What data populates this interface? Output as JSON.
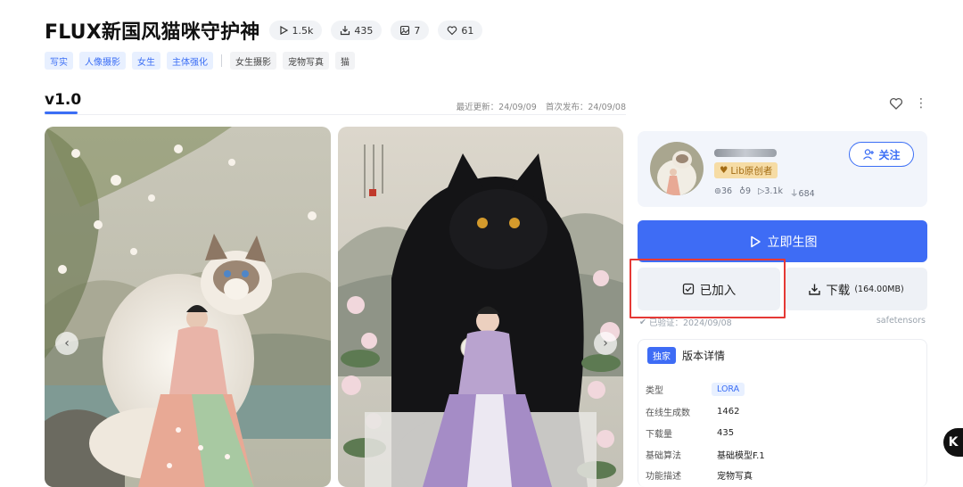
{
  "title": "FLUX新国风猫咪守护神",
  "stats": {
    "views": "1.5k",
    "downloads": "435",
    "images": "7",
    "likes": "61"
  },
  "tags": {
    "primary": [
      "写实",
      "人像摄影",
      "女生",
      "主体强化"
    ],
    "secondary": [
      "女生摄影",
      "宠物写真",
      "猫"
    ]
  },
  "version": "v1.0",
  "dates": {
    "updated": "最近更新：24/09/09",
    "published": "首次发布：24/09/08"
  },
  "creator": {
    "badge": "Lib原创者",
    "stats": {
      "followers": "36",
      "likes": "9",
      "views": "3.1k",
      "downloads": "684"
    },
    "follow_label": "关注"
  },
  "actions": {
    "generate_label": "立即生图",
    "added_label": "已加入",
    "download_label": "下载",
    "download_size": "(164.00MB)"
  },
  "verified": "已验证：2024/09/08",
  "format": "safetensors",
  "details": {
    "exclusive_label": "独家",
    "title": "版本详情",
    "rows": [
      {
        "label": "类型",
        "value": "LORA"
      },
      {
        "label": "在线生成数",
        "value": "1462"
      },
      {
        "label": "下载量",
        "value": "435"
      },
      {
        "label": "基础算法",
        "value": "基础模型F.1"
      },
      {
        "label": "功能描述",
        "value": "宠物写真"
      }
    ]
  },
  "floating_button": "K",
  "colors": {
    "accent": "#3e6cf5",
    "highlight_box": "#e53935",
    "creator_badge": "#f6dca5"
  }
}
